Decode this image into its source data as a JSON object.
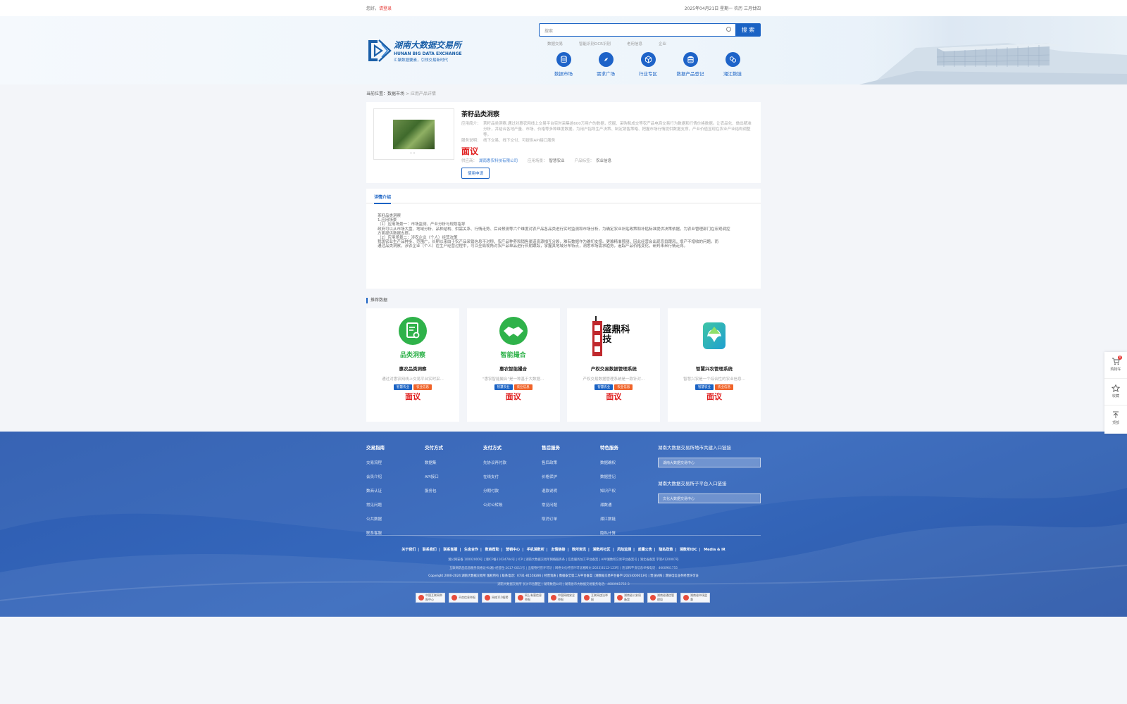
{
  "topbar": {
    "greeting": "您好，",
    "login": "请登录",
    "date": "2025年04月21日 星期一  农历 三月廿四"
  },
  "logo": {
    "name_cn": "湖南大数据交易所",
    "name_en": "HUNAN BIG DATA EXCHANGE",
    "slogan": "汇聚数据要素，引领交易新时代"
  },
  "search": {
    "placeholder": "搜索",
    "button": "搜 索",
    "hot": [
      "数据交易",
      "智能识别OCR识别",
      "老用信息",
      "企业"
    ]
  },
  "categories": [
    {
      "label": "数据市场",
      "icon": "database-icon"
    },
    {
      "label": "需求广场",
      "icon": "compass-icon"
    },
    {
      "label": "行业专区",
      "icon": "cube-icon"
    },
    {
      "label": "数据产品登记",
      "icon": "stack-icon"
    },
    {
      "label": "湘江数链",
      "icon": "link-icon"
    }
  ],
  "breadcrumb": {
    "current": "当前位置：",
    "market": "数据市场",
    "sep": ">",
    "page": "应用产品详情"
  },
  "product": {
    "title": "茶籽品类洞察",
    "intro_label": "应用简介：",
    "intro": "茶籽品类洞察,通过对惠农网线上交易平台实时采集逾600万用户的数据，挖掘、采购和成交等农产品电商交易行为数据和行情价格数据。让农品化、做出精准分析，并结合各地产量、市场、价格等多种维度数据，为用户指导生产决策、制定销售策略、把握市场行情提供数据支撑，产业价值显现在农业产业结构调整等。",
    "method_label": "服务说明：",
    "method": "线下交易、线下交付、可提供API接口服务",
    "price": "面议",
    "supplier_label": "供应商：",
    "supplier": "湖南惠农科技有限公司",
    "scene_label": "应用场景：",
    "scene": "智慧农业",
    "tag_label": "产品标签：",
    "tag": "农业信息",
    "apply": "使用申请",
    "thumb_dots": "• •"
  },
  "detail": {
    "tab": "详情介绍",
    "lines": [
      "茶籽品类洞察",
      "1.应用场景",
      "（1）应用场景一：市场监测、产业分析与规划指导",
      "政府可以从市场大盘、地域分析、品种结构、供需关系、行情走势、后台预测等六个维度对农产品各品类进行实时监测和市场分析，为确定农业补贴政策和补贴标准提供决策依据，为农业管理部门在宏观调控",
      "方面提供数据支撑。",
      "（2）应用场景二：涉农企业（个人）经营决策",
      "我国农业生产品种多、范围广，长期以来由于农产品采销信息不对称，农产品种养和销售渠道资源相互分裂，难有数据作为确切支撑。更难精准预测，因此经营会出现盲目跟风，增产不增收的问题。而",
      "通过品类洞察，涉农企业（个人）在生产经营过程中，可以全局视角对农产品单品进行长期跟踪，掌握其地域分布特点，洞悉市场需求趋势，追踪产品价格变化，研判未来行情走向。"
    ]
  },
  "recommend": {
    "title": "推荐数据",
    "items": [
      {
        "name": "惠农品类洞察",
        "logo_text": "品类洞察",
        "desc": "通过对惠农网线上交易平台实时采...",
        "tag1": "智慧农业",
        "tag2": "农业信息",
        "price": "面议"
      },
      {
        "name": "惠农智能撮合",
        "logo_text": "智能撮合",
        "desc": "\"惠农智能撮合\"是一种基于大数据...",
        "tag1": "智慧农业",
        "tag2": "农业信息",
        "price": "面议"
      },
      {
        "name": "产权交易数据管理系统",
        "logo_text": "盛鼎科技",
        "desc": "产权交易数据管理系统是一款针对...",
        "tag1": "智慧农业",
        "tag2": "农业信息",
        "price": "面议"
      },
      {
        "name": "智慧兴农管理系统",
        "logo_text": "",
        "desc": "智慧兴农是一个综合性的农业信息...",
        "tag1": "智慧农业",
        "tag2": "农业信息",
        "price": "面议"
      }
    ]
  },
  "footer": {
    "columns": [
      {
        "title": "交易指南",
        "items": [
          "交易流程",
          "会员介绍",
          "数商认证",
          "常见问题",
          "公共数据",
          "联系客服"
        ]
      },
      {
        "title": "交付方式",
        "items": [
          "数据集",
          "API接口",
          "服务包"
        ]
      },
      {
        "title": "支付方式",
        "items": [
          "先协议再付款",
          "在线支付",
          "分期付款",
          "公对公转账"
        ]
      },
      {
        "title": "售后服务",
        "items": [
          "售后政策",
          "价格保护",
          "退款说明",
          "常见问题",
          "取消订单"
        ]
      },
      {
        "title": "特色服务",
        "items": [
          "数据确权",
          "数据登记",
          "知识产权",
          "湘数通",
          "湘江数链",
          "隐私计算"
        ]
      }
    ],
    "side1_title": "湖南大数据交易所地市共建入口链接",
    "side1_select": "湖南大数据交易中心",
    "side2_title": "湖南大数据交易所子平台入口链接",
    "side2_select": "文化大数据交易中心",
    "links": [
      "关于我们",
      "联系我们",
      "联系客服",
      "生态合作",
      "数商帮助",
      "营销中心",
      "手机湘数所",
      "友情链接",
      "数所资讯",
      "湘数所社区",
      "风险监测",
      "质量公告",
      "隐私政策",
      "湘数所IDC",
      "Media & IR"
    ],
    "meta_lines": [
      "湘公网安备 10002000号  |  湘ICP备11024784号  |  ICP  |  湖南大数据交易所网络服务条  |  信息服务加工平台备案  |  APP湘数所交易平台备案号  |  湖北省备案 字第A120007号",
      "互联网药品信息服务资格证书(湘)-经营性-2017-0015号  |  出版物经营许可证  |  网络文化经营许可证湘网文(2023)3112-123号  |  违法和不良信息举报电话：4000961755",
      "Copyright 2000-2024 湖南大数据交易所 版权所有  |  联系电话：0731-81558286  |  经营资质  |  数据安全第二方平台备案  |  湘数据交易平台备字(2023)000013号  |  营业执照  |  增值电信业务经营许可证",
      "湖南大数据交易所 长沙市岳麓区  |  湖南数链公司  |  湖南省市大数据交易服务电话：4000961755-3"
    ],
    "badges": [
      "中国互联网举报中心",
      "不良信息举报",
      "网络110报警",
      "网上有害信息举报",
      "中国网络安全举报",
      "互联网违法举报",
      "湖南省公安局备案",
      "湖南省通信管理局",
      "湖南省市场监督"
    ]
  },
  "float": {
    "cart": "购物车",
    "cart_count": "0",
    "collect": "收藏",
    "top": "顶部"
  }
}
